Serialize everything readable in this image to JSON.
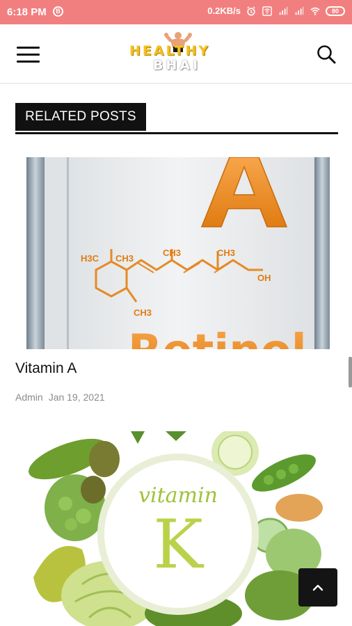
{
  "status_bar": {
    "time": "6:18 PM",
    "b_badge": "B",
    "net_speed": "0.2KB/s",
    "battery": "80",
    "icons": [
      "alarm-icon",
      "vowifi-icon",
      "signal-icon",
      "signal-icon",
      "wifi-icon",
      "battery-icon"
    ]
  },
  "header": {
    "logo_top": "HEALTHY",
    "logo_bottom": "BHAI",
    "menu_icon": "hamburger-icon",
    "search_icon": "search-icon"
  },
  "related": {
    "heading": "RELATED POSTS"
  },
  "posts": [
    {
      "title": "Vitamin A",
      "author": "Admin",
      "date": "Jan 19, 2021",
      "image_text": {
        "letter": "A",
        "word": "Retinol",
        "formula": [
          "H3C",
          "CH3",
          "CH3",
          "CH3",
          "OH",
          "CH3"
        ]
      }
    },
    {
      "image_text": {
        "word": "vitamin",
        "letter": "K"
      }
    }
  ],
  "back_to_top_icon": "chevron-up-icon",
  "colors": {
    "status_bar": "#f27f7f",
    "heading_bg": "#111111",
    "logo_yellow": "#f4c21f",
    "vitamin_green": "#9fc23a"
  }
}
